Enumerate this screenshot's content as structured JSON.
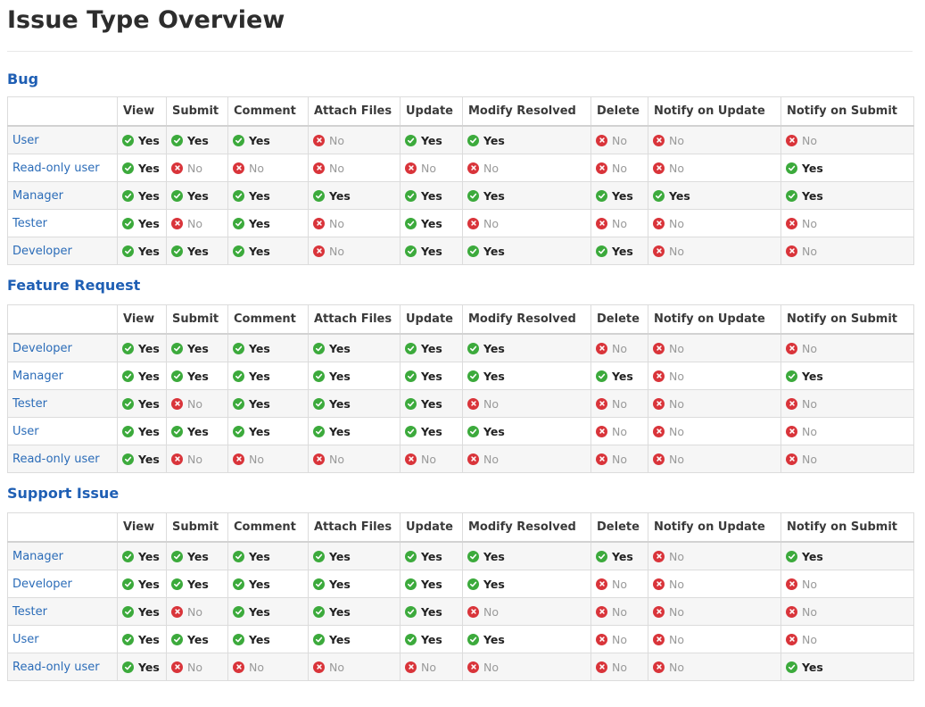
{
  "page": {
    "title": "Issue Type Overview"
  },
  "labels": {
    "yes": "Yes",
    "no": "No"
  },
  "colors": {
    "heading": "#1f5fb4",
    "link": "#2b6cb8",
    "yes_icon": "#3caa3c",
    "no_icon": "#d9343a"
  },
  "icons": {
    "yes": "check-circle-icon",
    "no": "x-circle-icon"
  },
  "columns": [
    "View",
    "Submit",
    "Comment",
    "Attach Files",
    "Update",
    "Modify Resolved",
    "Delete",
    "Notify on Update",
    "Notify on Submit"
  ],
  "sections": [
    {
      "title": "Bug",
      "rows": [
        {
          "role": "User",
          "perms": [
            true,
            true,
            true,
            false,
            true,
            true,
            false,
            false,
            false
          ]
        },
        {
          "role": "Read-only user",
          "perms": [
            true,
            false,
            false,
            false,
            false,
            false,
            false,
            false,
            true
          ]
        },
        {
          "role": "Manager",
          "perms": [
            true,
            true,
            true,
            true,
            true,
            true,
            true,
            true,
            true
          ]
        },
        {
          "role": "Tester",
          "perms": [
            true,
            false,
            true,
            false,
            true,
            false,
            false,
            false,
            false
          ]
        },
        {
          "role": "Developer",
          "perms": [
            true,
            true,
            true,
            false,
            true,
            true,
            true,
            false,
            false
          ]
        }
      ]
    },
    {
      "title": "Feature Request",
      "rows": [
        {
          "role": "Developer",
          "perms": [
            true,
            true,
            true,
            true,
            true,
            true,
            false,
            false,
            false
          ]
        },
        {
          "role": "Manager",
          "perms": [
            true,
            true,
            true,
            true,
            true,
            true,
            true,
            false,
            true
          ]
        },
        {
          "role": "Tester",
          "perms": [
            true,
            false,
            true,
            true,
            true,
            false,
            false,
            false,
            false
          ]
        },
        {
          "role": "User",
          "perms": [
            true,
            true,
            true,
            true,
            true,
            true,
            false,
            false,
            false
          ]
        },
        {
          "role": "Read-only user",
          "perms": [
            true,
            false,
            false,
            false,
            false,
            false,
            false,
            false,
            false
          ]
        }
      ]
    },
    {
      "title": "Support Issue",
      "rows": [
        {
          "role": "Manager",
          "perms": [
            true,
            true,
            true,
            true,
            true,
            true,
            true,
            false,
            true
          ]
        },
        {
          "role": "Developer",
          "perms": [
            true,
            true,
            true,
            true,
            true,
            true,
            false,
            false,
            false
          ]
        },
        {
          "role": "Tester",
          "perms": [
            true,
            false,
            true,
            true,
            true,
            false,
            false,
            false,
            false
          ]
        },
        {
          "role": "User",
          "perms": [
            true,
            true,
            true,
            true,
            true,
            true,
            false,
            false,
            false
          ]
        },
        {
          "role": "Read-only user",
          "perms": [
            true,
            false,
            false,
            false,
            false,
            false,
            false,
            false,
            true
          ]
        }
      ]
    }
  ]
}
